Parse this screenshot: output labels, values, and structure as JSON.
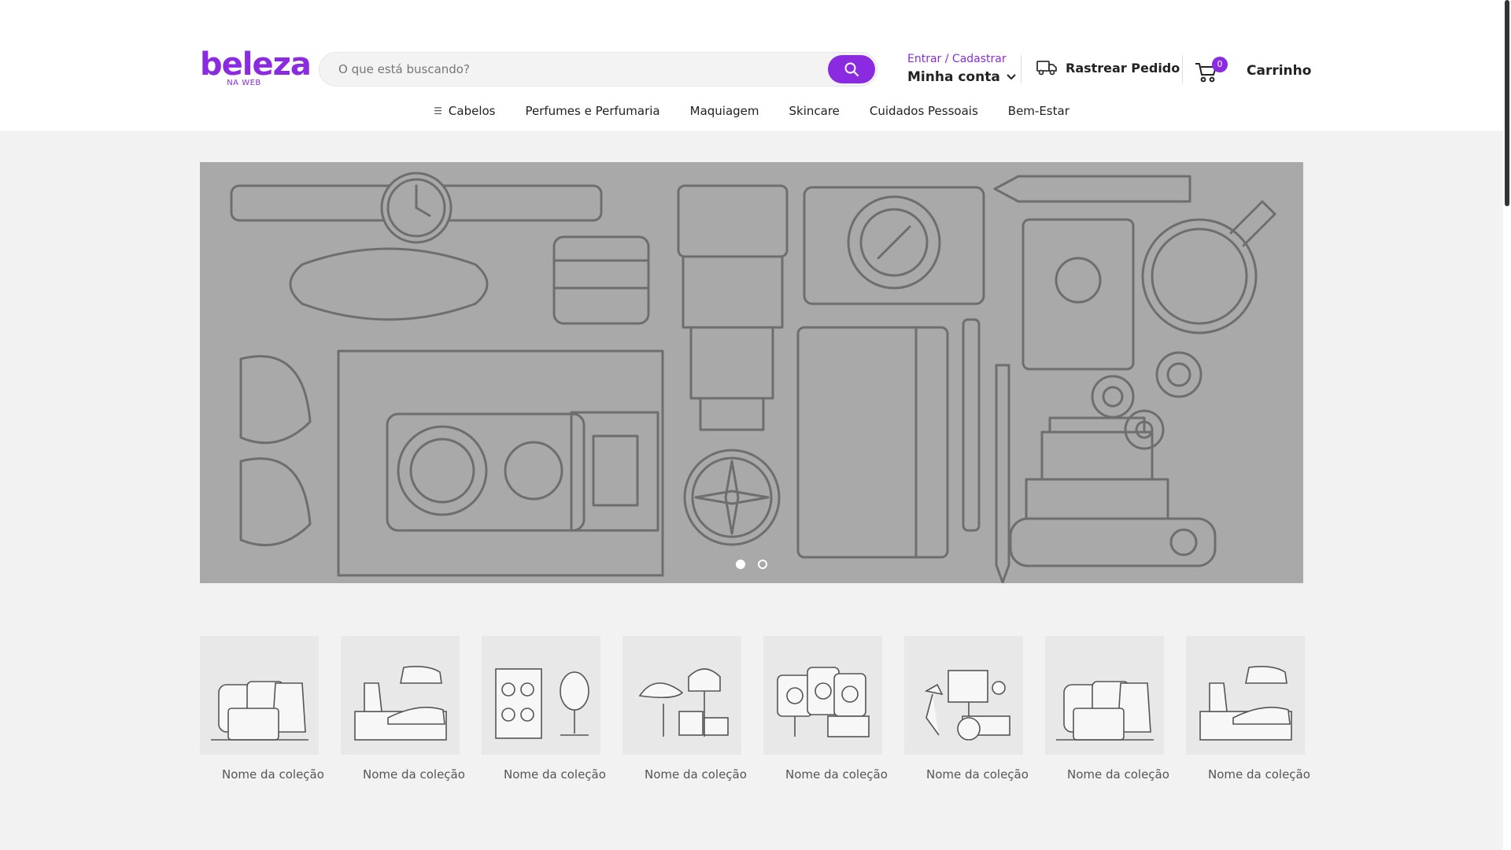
{
  "brand": {
    "name": "beleza",
    "subtitle": "NA WEB",
    "color": "#8a2be2"
  },
  "search": {
    "placeholder": "O que está buscando?",
    "button_icon": "search-icon"
  },
  "account": {
    "login_label": "Entrar / Cadastrar",
    "my_account_label": "Minha conta"
  },
  "track_order": {
    "label": "Rastrear Pedido",
    "icon": "truck-icon"
  },
  "cart": {
    "count": "0",
    "label": "Carrinho",
    "icon": "cart-icon"
  },
  "menu": {
    "items": [
      {
        "label": "Cabelos",
        "icon": "menu-icon"
      },
      {
        "label": "Perfumes e Perfumaria"
      },
      {
        "label": "Maquiagem"
      },
      {
        "label": "Skincare"
      },
      {
        "label": "Cuidados Pessoais"
      },
      {
        "label": "Bem-Estar"
      }
    ]
  },
  "banner": {
    "slides": 2,
    "active_slide": 1
  },
  "collections": {
    "items": [
      {
        "name": "Nome da coleção",
        "image": "bags-illustration"
      },
      {
        "name": "Nome da coleção",
        "image": "shoes-illustration"
      },
      {
        "name": "Nome da coleção",
        "image": "sunglasses-illustration"
      },
      {
        "name": "Nome da coleção",
        "image": "hats-illustration"
      },
      {
        "name": "Nome da coleção",
        "image": "watches-illustration"
      },
      {
        "name": "Nome da coleção",
        "image": "lamps-illustration"
      },
      {
        "name": "Nome da coleção",
        "image": "bags-illustration"
      },
      {
        "name": "Nome da coleção",
        "image": "shoes-illustration"
      }
    ]
  }
}
